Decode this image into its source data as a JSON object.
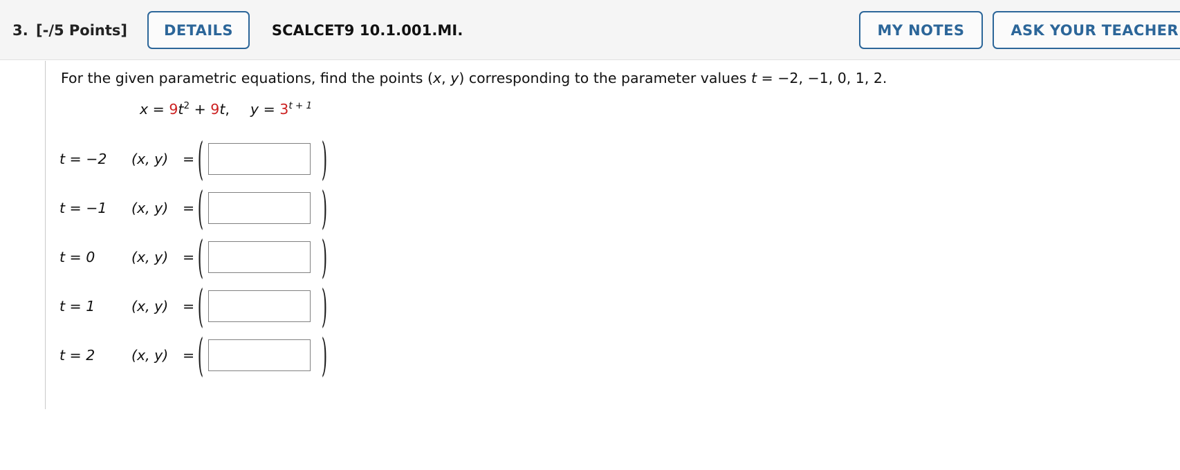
{
  "header": {
    "question_number": "3.",
    "points": "[-/5 Points]",
    "details_button": "DETAILS",
    "textbook_code": "SCALCET9 10.1.001.MI.",
    "my_notes_button": "MY NOTES",
    "ask_teacher_button": "ASK YOUR TEACHER",
    "accent_color": "#2c6699",
    "bar_color": "#f5f5f5"
  },
  "question": {
    "prompt_part1": "For the given parametric equations, find the points (",
    "prompt_x": "x",
    "prompt_comma": ", ",
    "prompt_y": "y",
    "prompt_part2": ") corresponding to the parameter values ",
    "prompt_t": "t",
    "prompt_part3": " = −2, −1, 0, 1, 2.",
    "equation": {
      "x_var": "x",
      "x_equals": " = ",
      "x_coef1": "9",
      "x_term1_base": "t",
      "x_term1_exp": "2",
      "x_plus": " + ",
      "x_coef2": "9",
      "x_term2_base": "t",
      "x_trailing_comma": ",",
      "y_var": "y",
      "y_equals": " = ",
      "y_coef": "3",
      "y_exp": "t + 1",
      "coefficient_color": "#cc2020"
    }
  },
  "answer_rows": [
    {
      "t_label": "t = −2",
      "xy_label": "(x, y)",
      "equals": "=",
      "paren_open": "(",
      "paren_close": ")",
      "value": "",
      "placeholder": ""
    },
    {
      "t_label": "t = −1",
      "xy_label": "(x, y)",
      "equals": "=",
      "paren_open": "(",
      "paren_close": ")",
      "value": "",
      "placeholder": ""
    },
    {
      "t_label": "t = 0",
      "xy_label": "(x, y)",
      "equals": "=",
      "paren_open": "(",
      "paren_close": ")",
      "value": "",
      "placeholder": ""
    },
    {
      "t_label": "t = 1",
      "xy_label": "(x, y)",
      "equals": "=",
      "paren_open": "(",
      "paren_close": ")",
      "value": "",
      "placeholder": ""
    },
    {
      "t_label": "t = 2",
      "xy_label": "(x, y)",
      "equals": "=",
      "paren_open": "(",
      "paren_close": ")",
      "value": "",
      "placeholder": ""
    }
  ]
}
